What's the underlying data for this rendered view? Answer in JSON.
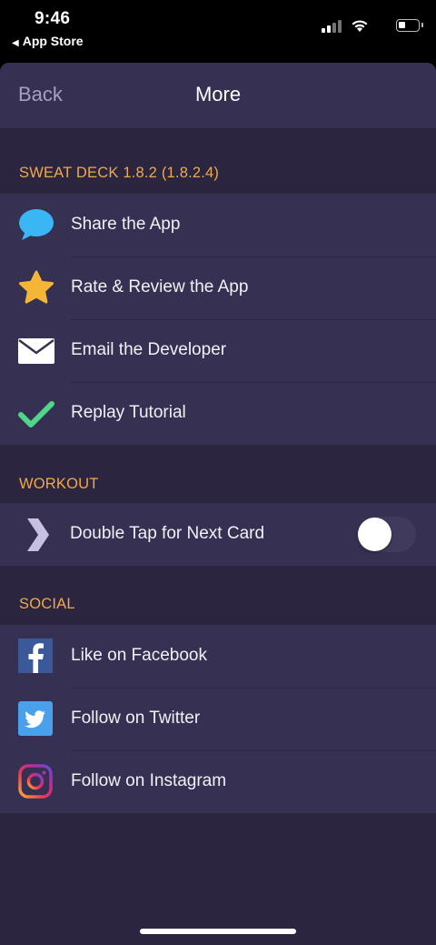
{
  "status_bar": {
    "time": "9:46",
    "back_app": "App Store"
  },
  "nav": {
    "back_label": "Back",
    "title": "More"
  },
  "sections": {
    "about": {
      "header": "SWEAT DECK 1.8.2 (1.8.2.4)",
      "items": [
        {
          "label": "Share the App",
          "icon": "chat-bubble-icon"
        },
        {
          "label": "Rate & Review the App",
          "icon": "star-icon"
        },
        {
          "label": "Email the Developer",
          "icon": "envelope-icon"
        },
        {
          "label": "Replay Tutorial",
          "icon": "checkmark-icon"
        }
      ]
    },
    "workout": {
      "header": "WORKOUT",
      "items": [
        {
          "label": "Double Tap for Next Card",
          "icon": "chevron-right-icon",
          "toggle_on": false
        }
      ]
    },
    "social": {
      "header": "SOCIAL",
      "items": [
        {
          "label": "Like on Facebook",
          "icon": "facebook-icon"
        },
        {
          "label": "Follow on Twitter",
          "icon": "twitter-icon"
        },
        {
          "label": "Follow on Instagram",
          "icon": "instagram-icon"
        }
      ]
    }
  },
  "colors": {
    "background": "#2b2540",
    "cell": "#363052",
    "section_header": "#f0a948",
    "nav_back": "#a6a1bd"
  }
}
